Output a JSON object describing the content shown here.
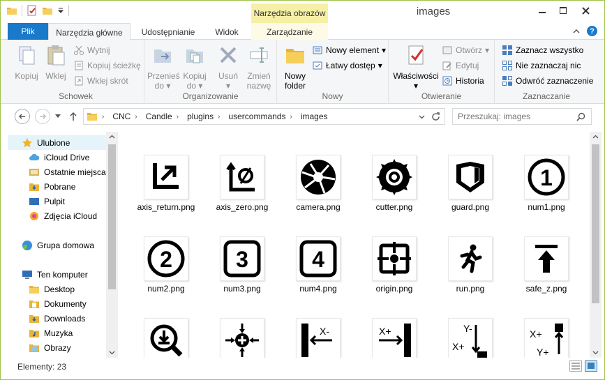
{
  "window": {
    "title": "images",
    "context_tab": "Narzędzia obrazów"
  },
  "ribbon_tabs": {
    "file": "Plik",
    "home": "Narzędzia główne",
    "share": "Udostępnianie",
    "view": "Widok",
    "manage": "Zarządzanie"
  },
  "ribbon": {
    "clipboard": {
      "label": "Schowek",
      "copy": "Kopiuj",
      "paste": "Wklej",
      "cut": "Wytnij",
      "copy_path": "Kopiuj ścieżkę",
      "paste_shortcut": "Wklej skrót"
    },
    "organize": {
      "label": "Organizowanie",
      "move_to_1": "Przenieś",
      "move_to_2": "do",
      "copy_to_1": "Kopiuj",
      "copy_to_2": "do",
      "delete": "Usuń",
      "rename_1": "Zmień",
      "rename_2": "nazwę"
    },
    "new": {
      "label": "Nowy",
      "new_folder_1": "Nowy",
      "new_folder_2": "folder",
      "new_item": "Nowy element",
      "easy_access": "Łatwy dostęp"
    },
    "open": {
      "label": "Otwieranie",
      "properties": "Właściwości",
      "open": "Otwórz",
      "edit": "Edytuj",
      "history": "Historia"
    },
    "select": {
      "label": "Zaznaczanie",
      "select_all": "Zaznacz wszystko",
      "select_none": "Nie zaznaczaj nic",
      "invert": "Odwróć zaznaczenie"
    }
  },
  "address": {
    "crumbs": [
      "CNC",
      "Candle",
      "plugins",
      "usercommands",
      "images"
    ],
    "search_placeholder": "Przeszukaj: images"
  },
  "nav": {
    "favorites": "Ulubione",
    "icloud_drive": "iCloud Drive",
    "recent": "Ostatnie miejsca",
    "downloads_fav": "Pobrane",
    "desktop_fav": "Pulpit",
    "icloud_photos": "Zdjęcia iCloud",
    "homegroup": "Grupa domowa",
    "this_pc": "Ten komputer",
    "desktop": "Desktop",
    "documents": "Dokumenty",
    "downloads": "Downloads",
    "music": "Muzyka",
    "pictures": "Obrazy"
  },
  "files": [
    {
      "name": "axis_return.png",
      "icon": "axis-return-icon"
    },
    {
      "name": "axis_zero.png",
      "icon": "axis-zero-icon"
    },
    {
      "name": "camera.png",
      "icon": "camera-aperture-icon"
    },
    {
      "name": "cutter.png",
      "icon": "cutter-icon"
    },
    {
      "name": "guard.png",
      "icon": "guard-shield-icon"
    },
    {
      "name": "num1.png",
      "icon": "number-1-icon"
    },
    {
      "name": "num2.png",
      "icon": "number-2-icon"
    },
    {
      "name": "num3.png",
      "icon": "number-3-icon"
    },
    {
      "name": "num4.png",
      "icon": "number-4-icon"
    },
    {
      "name": "origin.png",
      "icon": "origin-crosshair-icon"
    },
    {
      "name": "run.png",
      "icon": "running-man-icon"
    },
    {
      "name": "safe_z.png",
      "icon": "safe-z-icon"
    }
  ],
  "partial_row_labels": {
    "x_minus": "X-",
    "x_plus": "X+",
    "y_minus": "Y-",
    "y_plus": "Y+"
  },
  "status": {
    "count": "Elementy: 23"
  },
  "colors": {
    "accent": "#1979ca",
    "context_tab": "#f6f0a6",
    "window_border": "#9fc34a"
  }
}
